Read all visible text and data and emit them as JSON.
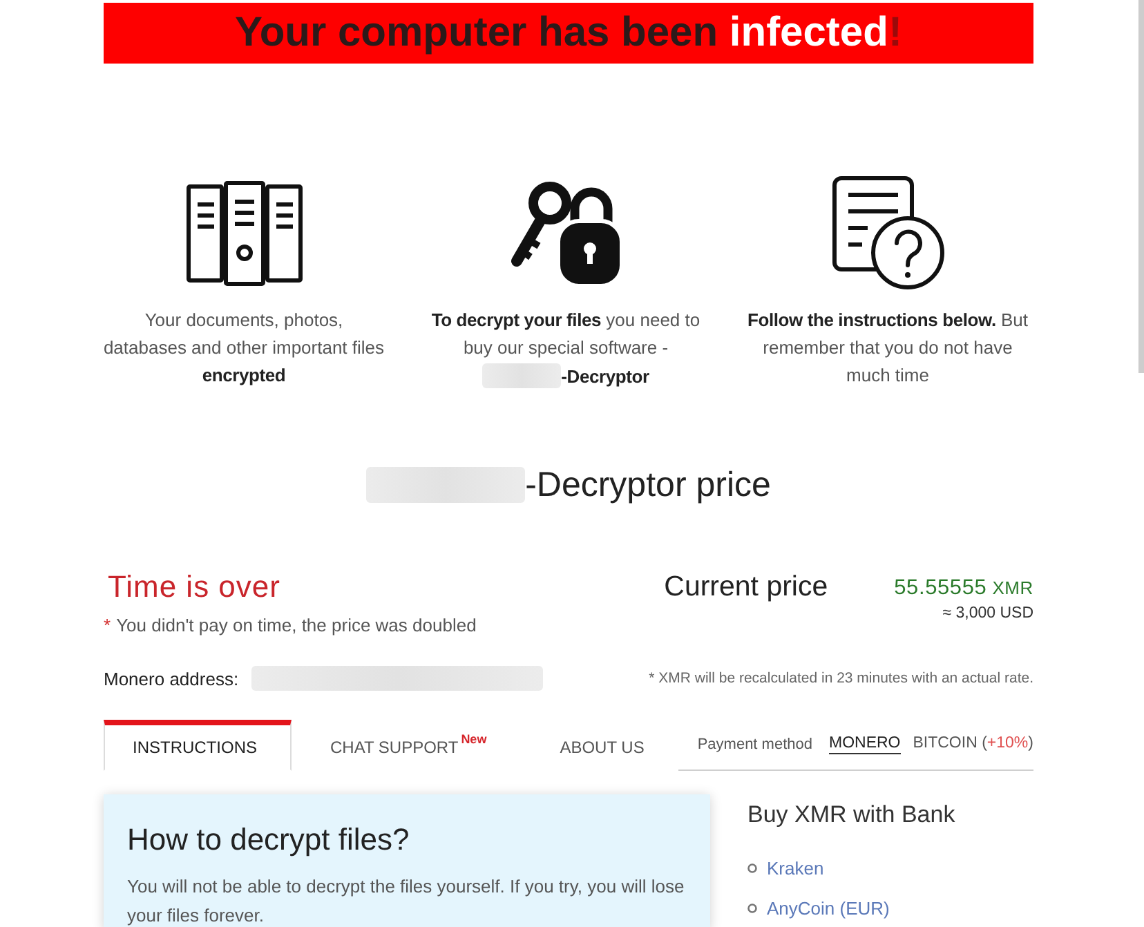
{
  "banner": {
    "text": "Your computer has been ",
    "highlight": "infected",
    "end": "!"
  },
  "features": [
    {
      "kind": "cabinets",
      "text": "Your documents, photos, databases and other important files **encrypted**"
    },
    {
      "kind": "key-lock",
      "text": "**To decrypt your files** you need to buy our special software -",
      "product": "-Decryptor"
    },
    {
      "kind": "document-question",
      "text": "**Follow the instructions below.** But remember that you do not have much time"
    }
  ],
  "price_title": "-Decryptor price",
  "timer": {
    "status": "Time is over",
    "note_mark": "*",
    "note": "You didn't pay on time, the price was doubled"
  },
  "price": {
    "label": "Current price",
    "amount": "55.55555",
    "currency": "XMR",
    "approx": "≈ 3,000 USD"
  },
  "address": {
    "label": "Monero address:"
  },
  "rate_note": "* XMR will be recalculated in 23 minutes with an actual rate.",
  "tabs": [
    {
      "label": "INSTRUCTIONS",
      "selected": true
    },
    {
      "label": "CHAT SUPPORT",
      "badge": "New",
      "selected": false
    },
    {
      "label": "ABOUT US",
      "selected": false
    }
  ],
  "payment": {
    "label": "Payment method",
    "methods": [
      {
        "label": "MONERO",
        "selected": true
      },
      {
        "label": "BITCOIN",
        "surcharge": [
          "(",
          "+10%",
          ")"
        ],
        "selected": false
      }
    ]
  },
  "instructions": {
    "title": "How to decrypt files?",
    "text": "You will not be able to decrypt the files yourself. If you try, you will lose your files forever."
  },
  "bank": {
    "title": "Buy XMR with Bank",
    "links": [
      "Kraken",
      "AnyCoin (EUR)"
    ]
  }
}
